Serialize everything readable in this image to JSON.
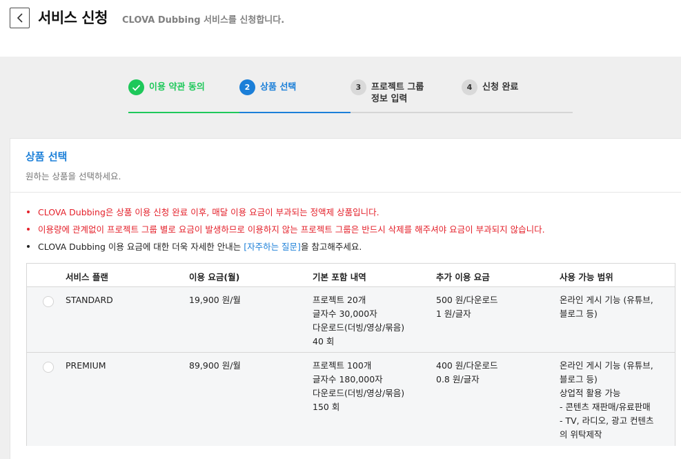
{
  "header": {
    "title": "서비스 신청",
    "subtitle": "CLOVA Dubbing 서비스를 신청합니다."
  },
  "stepper": {
    "steps": [
      {
        "number": "✓",
        "label": "이용 약관 동의",
        "state": "done"
      },
      {
        "number": "2",
        "label": "상품 선택",
        "state": "active"
      },
      {
        "number": "3",
        "label_line1": "프로젝트 그룹",
        "label_line2": "정보 입력",
        "state": "pending"
      },
      {
        "number": "4",
        "label": "신청 완료",
        "state": "pending"
      }
    ]
  },
  "card": {
    "title": "상품 선택",
    "description": "원하는 상품을 선택하세요.",
    "notices": [
      "CLOVA Dubbing은 상품 이용 신청 완료 이후, 매달 이용 요금이 부과되는 정액제 상품입니다.",
      "이용량에 관계없이 프로젝트 그룹 별로 요금이 발생하므로 이용하지 않는 프로젝트 그룹은 반드시 삭제를 해주셔야 요금이 부과되지 않습니다."
    ],
    "info_notice": {
      "before": "CLOVA Dubbing 이용 요금에 대한 더욱 자세한 안내는 ",
      "link": "[자주하는 질문]",
      "after": "을 참고해주세요."
    }
  },
  "table": {
    "headers": [
      "서비스 플랜",
      "이용 요금(월)",
      "기본 포함 내역",
      "추가 이용 요금",
      "사용 가능 범위"
    ],
    "rows": [
      {
        "plan": "STANDARD",
        "price": "19,900 원/월",
        "included": [
          "프로젝트 20개",
          "글자수 30,000자",
          "다운로드(더빙/영상/묶음)",
          "40 회"
        ],
        "extra": [
          "500 원/다운로드",
          "1 원/글자"
        ],
        "scope": [
          "온라인 게시 기능 (유튜브,",
          "블로그 등)"
        ]
      },
      {
        "plan": "PREMIUM",
        "price": "89,900 원/월",
        "included": [
          "프로젝트 100개",
          "글자수 180,000자",
          "다운로드(더빙/영상/묶음)",
          "150 회"
        ],
        "extra": [
          "400 원/다운로드",
          "0.8 원/글자"
        ],
        "scope": [
          "온라인 게시 기능 (유튜브,",
          "블로그 등)",
          "상업적 활용 가능",
          "- 콘텐츠 재판매/유료판매",
          "- TV, 라디오, 광고 컨텐츠",
          "의 위탁제작"
        ]
      }
    ]
  },
  "colors": {
    "done": "#1ec85a",
    "active": "#1b7fd8",
    "warning": "#e4202a"
  }
}
